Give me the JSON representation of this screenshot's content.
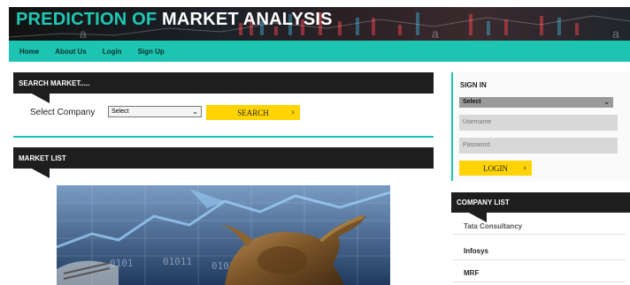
{
  "site": {
    "title_accent": "PREDICTION OF",
    "title_main": "MARKET ANALYSIS",
    "accent_color": "#1fc8b5"
  },
  "nav": {
    "items": [
      {
        "label": "Home"
      },
      {
        "label": "About Us"
      },
      {
        "label": "Login"
      },
      {
        "label": "Sign Up"
      }
    ]
  },
  "search": {
    "header": "SEARCH MARKET.....",
    "select_label": "Select Company",
    "select_value": "Select",
    "button_label": "SEARCH",
    "button_icon": "arrow-right-icon"
  },
  "market_list": {
    "header": "MARKET LIST",
    "image_icon": "bull-icon"
  },
  "signin": {
    "title": "SIGN IN",
    "select_value": "Select",
    "username_placeholder": "Username",
    "password_placeholder": "Password",
    "button_label": "LOGIN"
  },
  "company_list": {
    "header": "COMPANY LIST",
    "items": [
      {
        "label": "Tata Consultancy"
      },
      {
        "label": "Infosys"
      },
      {
        "label": "MRF"
      }
    ]
  }
}
